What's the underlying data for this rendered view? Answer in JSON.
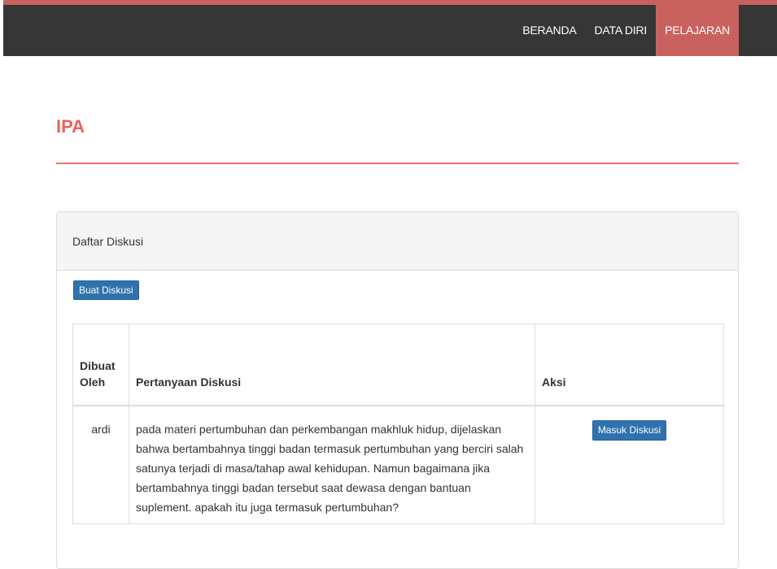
{
  "nav": {
    "items": [
      {
        "label": "BERANDA",
        "active": false
      },
      {
        "label": "DATA DIRI",
        "active": false
      },
      {
        "label": "PELAJARAN",
        "active": true
      }
    ]
  },
  "page": {
    "title": "IPA"
  },
  "panel": {
    "heading": "Daftar Diskusi",
    "create_button": "Buat Diskusi"
  },
  "table": {
    "headers": {
      "author": "Dibuat Oleh",
      "question": "Pertanyaan Diskusi",
      "action": "Aksi"
    },
    "rows": [
      {
        "author": "ardi",
        "question": "pada materi pertumbuhan dan perkembangan makhluk hidup, dijelaskan bahwa bertambahnya tinggi badan termasuk pertumbuhan yang berciri salah satunya terjadi di masa/tahap awal kehidupan. Namun bagaimana jika bertambahnya tinggi badan tersebut saat dewasa dengan bantuan suplement. apakah itu juga termasuk pertumbuhan?",
        "action_label": "Masuk Diskusi"
      }
    ]
  },
  "colors": {
    "accent": "#c9625f",
    "title": "#e8625a",
    "navbar": "#363636",
    "button": "#2f72ad"
  }
}
